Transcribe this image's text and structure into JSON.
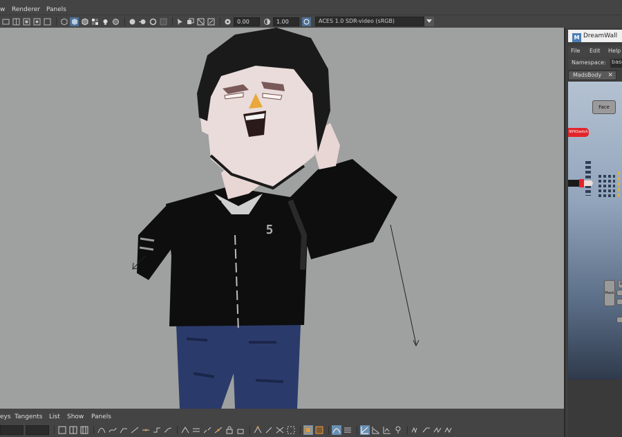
{
  "menubar": {
    "items": [
      "w",
      "Renderer",
      "Panels"
    ]
  },
  "toolbar": {
    "exposure": "0.00",
    "gamma": "1.00",
    "colorspace": "ACES 1.0 SDR-video (sRGB)"
  },
  "character": {
    "shirt_logo": "5"
  },
  "graph_editor": {
    "menu": [
      "eys",
      "Tangents",
      "List",
      "Show",
      "Panels"
    ]
  },
  "dreamwall": {
    "title": "DreamWall",
    "logo": "M",
    "menu": [
      "File",
      "Edit",
      "Help"
    ],
    "namespace_label": "Namespace:",
    "namespace_value": "base",
    "tab_label": "MadsBody",
    "tab_close": "✕",
    "face_button": "Face",
    "ikfk_label": "IKFKSwitch",
    "mask_button": "Mask",
    "b_button": "B"
  },
  "colors": {
    "viewport_bg": "#9fa0a0",
    "ui_bg": "#444444",
    "accent": "#6a8fb0",
    "ikfk": "#e3242b"
  }
}
